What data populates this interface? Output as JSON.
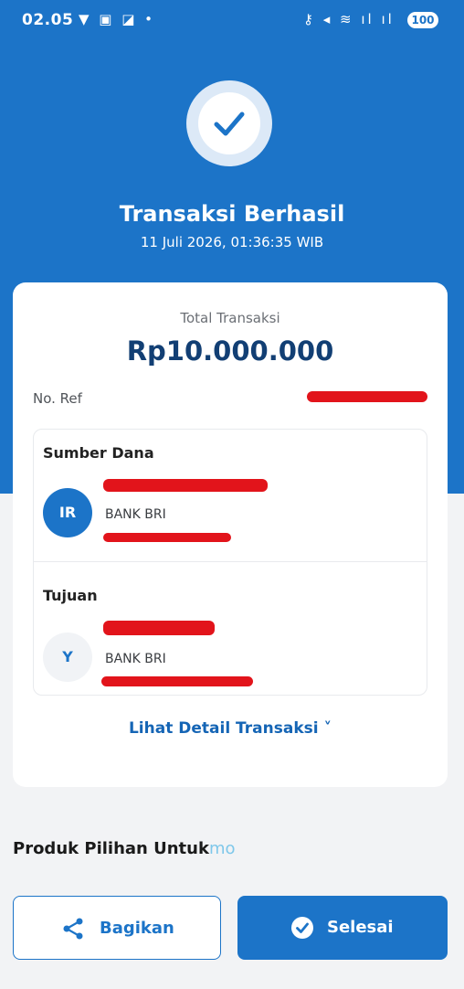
{
  "status_bar": {
    "time": "02.05",
    "left_icons": "▼ ▣ ◪ •",
    "right_icons": "⚷ ◂ ≋ ıl ıl",
    "battery": "100"
  },
  "header": {
    "icon": "check-icon",
    "title": "Transaksi Berhasil",
    "datetime": "11 Juli 2026, 01:36:35 WIB"
  },
  "summary": {
    "total_label": "Total Transaksi",
    "total_amount": "Rp10.000.000",
    "ref_label": "No. Ref"
  },
  "source": {
    "label": "Sumber Dana",
    "avatar": "IR",
    "bank": "BANK BRI"
  },
  "destination": {
    "label": "Tujuan",
    "avatar": "Y",
    "bank": "BANK BRI"
  },
  "detail_link": "Lihat Detail Transaksi ˅",
  "produk": {
    "title": "Produk Pilihan Untuk",
    "suffix": "mo"
  },
  "actions": {
    "share_label": "Bagikan",
    "share_icon": "share-icon",
    "done_label": "Selesai",
    "done_icon": "check-circle-icon"
  },
  "colors": {
    "primary": "#1c74c8",
    "amount": "#123f74",
    "redaction": "#e2141b"
  }
}
